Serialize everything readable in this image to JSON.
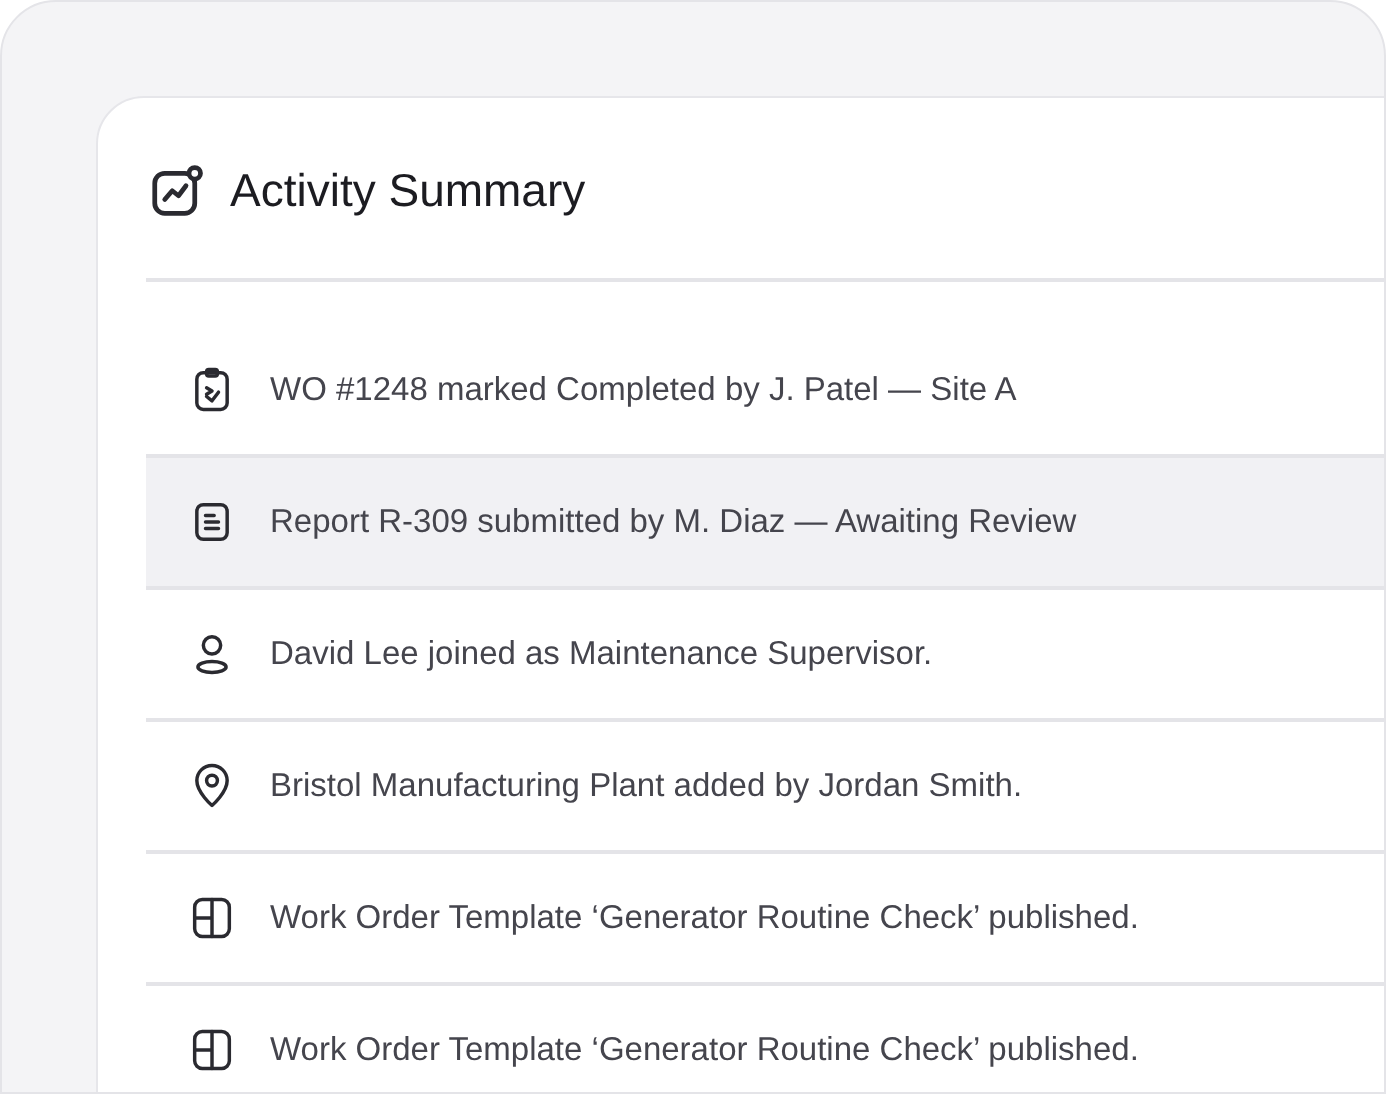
{
  "card": {
    "title": "Activity Summary"
  },
  "activities": [
    {
      "kind": "clipboard-check",
      "text": "WO #1248 marked Completed by J. Patel — Site A",
      "highlighted": false
    },
    {
      "kind": "document",
      "text": "Report R-309 submitted by M. Diaz — Awaiting Review",
      "highlighted": true
    },
    {
      "kind": "person",
      "text": "David Lee joined as Maintenance Supervisor.",
      "highlighted": false
    },
    {
      "kind": "location",
      "text": "Bristol Manufacturing Plant added by Jordan Smith.",
      "highlighted": false
    },
    {
      "kind": "template",
      "text": "Work Order Template ‘Generator Routine Check’ published.",
      "highlighted": false
    },
    {
      "kind": "template",
      "text": "Work Order Template ‘Generator Routine Check’ published.",
      "highlighted": false
    }
  ]
}
